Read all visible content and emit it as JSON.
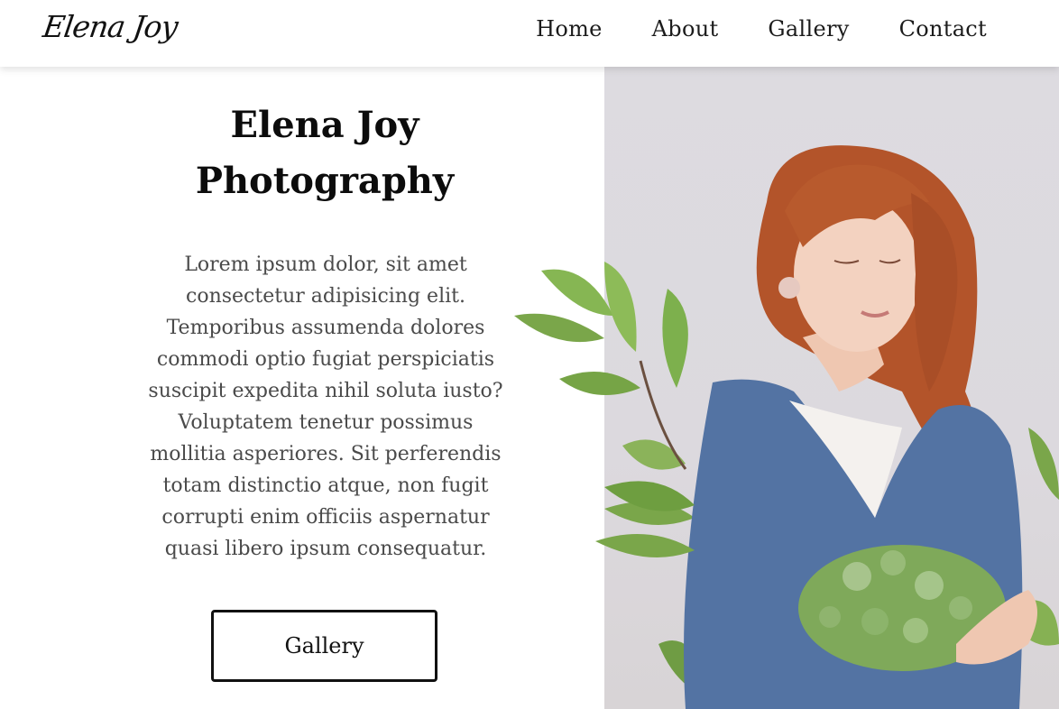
{
  "nav": {
    "logo": "Elena Joy",
    "links": [
      "Home",
      "About",
      "Gallery",
      "Contact"
    ]
  },
  "hero": {
    "title_line1": "Elena Joy",
    "title_line2": "Photography",
    "lines": [
      "Lorem ipsum dolor, sit amet",
      "consectetur adipisicing elit.",
      "Temporibus assumenda dolores",
      "commodi optio fugiat perspiciatis",
      "suscipit expedita nihil soluta iusto?",
      "Voluptatem tenetur possimus",
      "mollitia asperiores. Sit perferendis",
      "totam distinctio atque, non fugit",
      "corrupti enim officiis aspernatur",
      "quasi libero ipsum consequatur."
    ],
    "button_label": "Gallery"
  },
  "colors": {
    "background": "#ffffff",
    "text": "#111111",
    "body_text": "#4a4a4a",
    "photo_bg": "#dddbe0",
    "sweater": "#5373a3",
    "hair": "#b3542a",
    "leaf": "#7aa64a"
  }
}
